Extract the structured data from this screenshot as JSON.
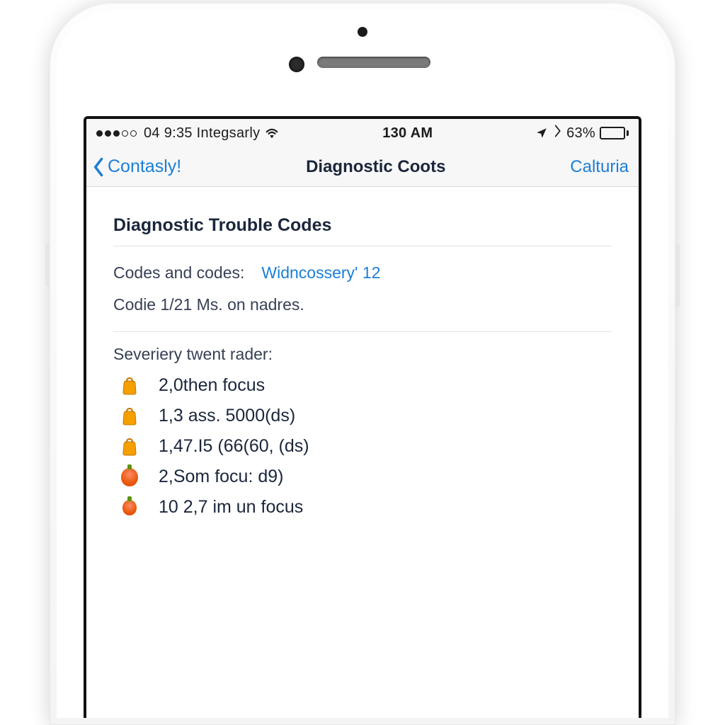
{
  "status_bar": {
    "carrier_text": "04 9:35 Integsarly",
    "time": "130 AM",
    "battery_percent": "63%"
  },
  "nav": {
    "back_label": "Contasly!",
    "title": "Diagnostic Coots",
    "right_label": "Calturia"
  },
  "section": {
    "title": "Diagnostic Trouble Codes",
    "codes_label": "Codes and codes:",
    "codes_link": "Widncossery' 12",
    "sub_line": "Codie 1/21 Ms. on nadres.",
    "severity_label": "Severiery twent rader:",
    "items": [
      {
        "severity": "orange",
        "text": "2,0then focus"
      },
      {
        "severity": "orange",
        "text": "1,3 ass. 5000(ds)"
      },
      {
        "severity": "orange",
        "text": "1,47.I5 (66(60, (ds)"
      },
      {
        "severity": "red",
        "text": "2,Som focu: d9)"
      },
      {
        "severity": "red",
        "text": "10 2,7 im un focus"
      }
    ]
  }
}
